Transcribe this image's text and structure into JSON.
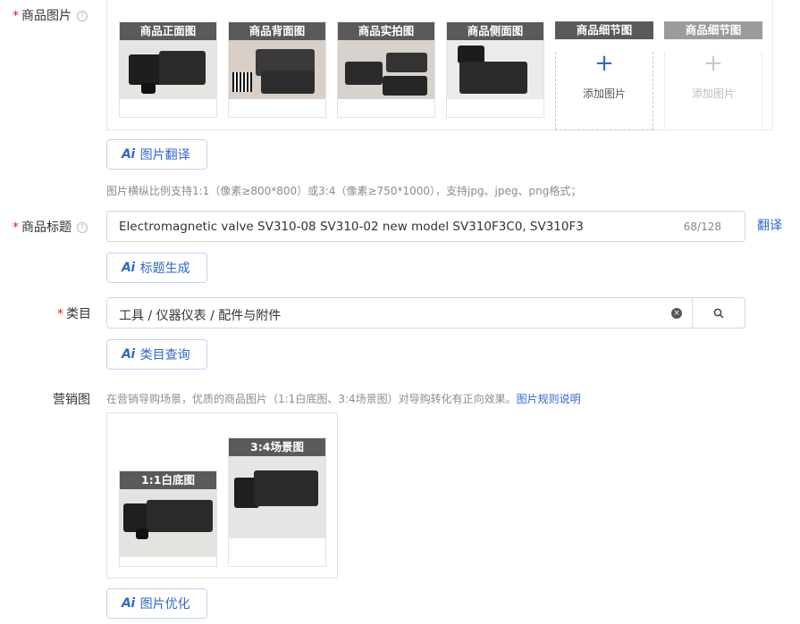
{
  "images_field": {
    "label": "商品图片",
    "help_icon": "question-circle-icon",
    "slots": [
      {
        "title": "商品正面图"
      },
      {
        "title": "商品背面图"
      },
      {
        "title": "商品实拍图"
      },
      {
        "title": "商品侧面图"
      },
      {
        "title": "商品细节图",
        "add_label": "添加图片",
        "add_symbol": "+"
      },
      {
        "title": "商品细节图",
        "add_label": "添加图片",
        "add_symbol": "+"
      }
    ],
    "translate_button": {
      "ai": "Ai",
      "label": "图片翻译"
    },
    "hint": "图片横纵比例支持1:1（像素≥800*800）或3:4（像素≥750*1000），支持jpg、jpeg、png格式；"
  },
  "title_field": {
    "label": "商品标题",
    "value": "Electromagnetic valve SV310-08 SV310-02 new model SV310F3C0, SV310F3",
    "count": "68/128",
    "translate_link": "翻译",
    "generate_button": {
      "ai": "Ai",
      "label": "标题生成"
    }
  },
  "category_field": {
    "label": "类目",
    "value": "工具 / 仪器仪表 / 配件与附件",
    "clear_icon": "clear-circle-icon",
    "search_icon": "search-icon",
    "query_button": {
      "ai": "Ai",
      "label": "类目查询"
    }
  },
  "marketing_field": {
    "label": "营销图",
    "hint": "在营销导购场景，优质的商品图片（1:1白底图、3:4场景图）对导购转化有正向效果。",
    "rules_link": "图片规则说明",
    "images": [
      {
        "title": "1:1白底图"
      },
      {
        "title": "3:4场景图"
      }
    ],
    "optimize_button": {
      "ai": "Ai",
      "label": "图片优化"
    }
  },
  "colors": {
    "accent": "#2f66d0",
    "required": "#e02020",
    "thumb_header": "#5a5a5a"
  }
}
